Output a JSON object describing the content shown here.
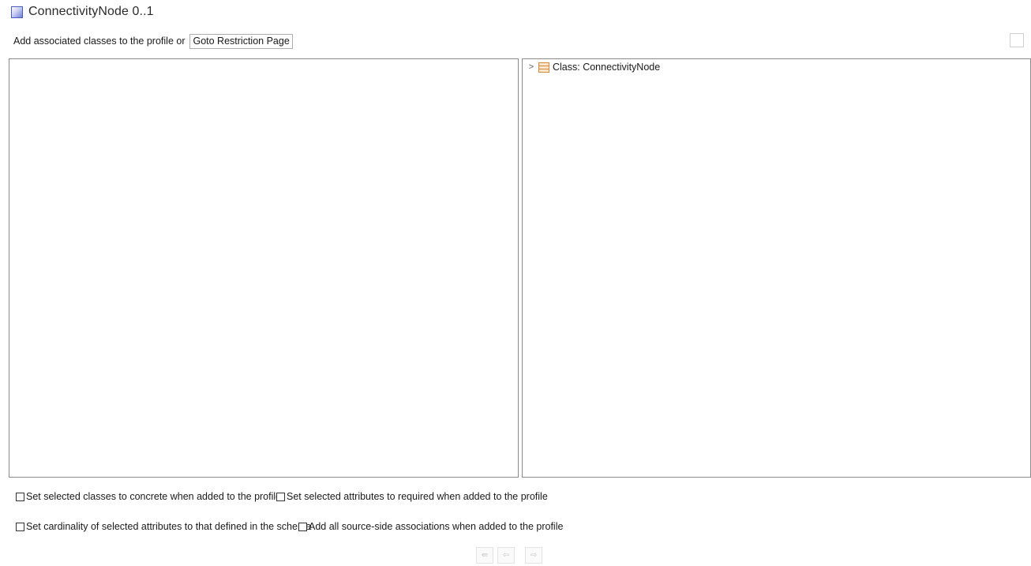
{
  "header": {
    "title": "ConnectivityNode 0..1",
    "icon": "class-square-icon"
  },
  "toolbar": {
    "prompt_text": "Add associated classes to the profile or",
    "goto_button_label": "Goto Restriction Page"
  },
  "right_tree": {
    "items": [
      {
        "label": "Class: ConnectivityNode",
        "icon": "class-icon",
        "expanded": false
      }
    ]
  },
  "options": {
    "concrete": {
      "label": "Set selected classes to concrete when added to the profile",
      "checked": false
    },
    "required": {
      "label": "Set selected attributes to required when added to the profile",
      "checked": false
    },
    "cardinality": {
      "label": "Set cardinality of selected attributes to that defined in the schema",
      "checked": false
    },
    "source_assoc": {
      "label": "Add all source-side associations when added to the profile",
      "checked": false
    }
  },
  "nav": {
    "buttons": [
      {
        "name": "remove-all-button",
        "glyph": "⇚"
      },
      {
        "name": "remove-button",
        "glyph": "⇦"
      },
      {
        "name": "add-button",
        "glyph": "⇨"
      }
    ]
  },
  "colors": {
    "panel_border": "#8a8a8a",
    "class_icon_orange": "#d9893a",
    "title_icon_blue": "#4a5bc4"
  }
}
